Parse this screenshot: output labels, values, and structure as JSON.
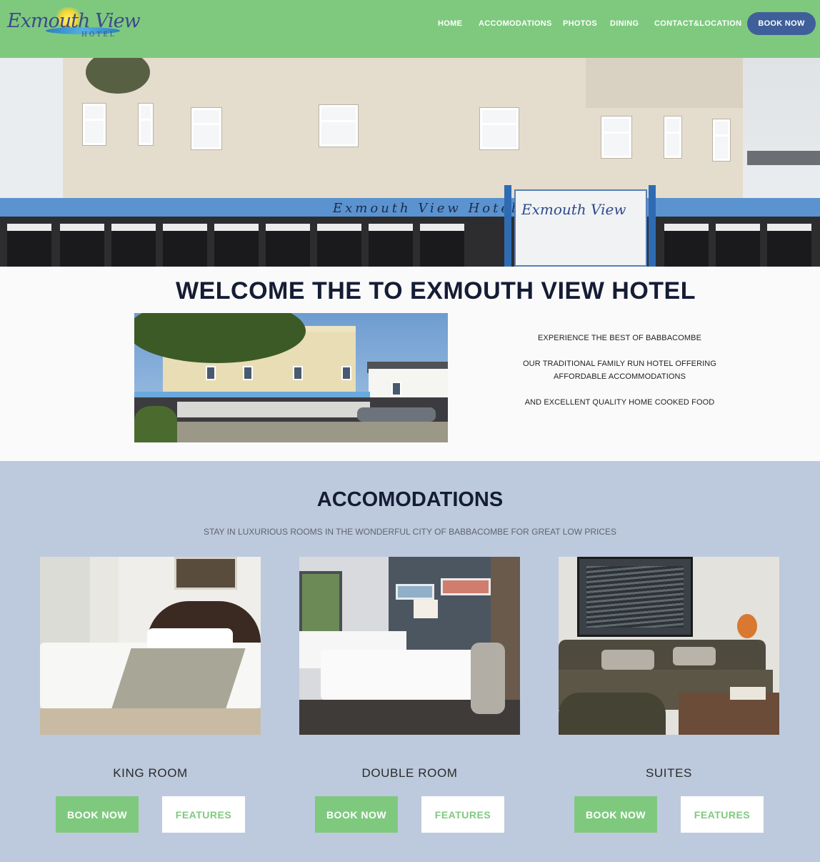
{
  "header": {
    "logo": {
      "name": "Exmouth View",
      "sub": "HOTEL"
    },
    "nav": [
      {
        "label": "HOME"
      },
      {
        "label": "ACCOMODATIONS"
      },
      {
        "label": "PHOTOS"
      },
      {
        "label": "DINING"
      },
      {
        "label": "CONTACT&LOCATION"
      }
    ],
    "book_label": "BOOK NOW"
  },
  "hero": {
    "canopy_text": "Exmouth  View  Hotel",
    "sign_text": "Exmouth View"
  },
  "welcome": {
    "title": "WELCOME THE TO EXMOUTH VIEW HOTEL",
    "lines": [
      "EXPERIENCE THE BEST OF BABBACOMBE",
      "OUR TRADITIONAL FAMILY RUN HOTEL OFFERING AFFORDABLE ACCOMMODATIONS",
      "AND EXCELLENT QUALITY HOME COOKED FOOD"
    ]
  },
  "accomodations": {
    "title": "ACCOMODATIONS",
    "subtitle": "STAY IN LUXURIOUS ROOMS IN THE WONDERFUL CITY OF BABBACOMBE FOR GREAT LOW PRICES",
    "rooms": [
      {
        "name": "KING ROOM",
        "book_label": "BOOK NOW",
        "features_label": "FEATURES"
      },
      {
        "name": "DOUBLE ROOM",
        "book_label": "BOOK NOW",
        "features_label": "FEATURES"
      },
      {
        "name": "SUITES",
        "book_label": "BOOK NOW",
        "features_label": "FEATURES"
      }
    ]
  },
  "colors": {
    "header_green": "#7fc97f",
    "nav_book_blue": "#3f5f9a",
    "accom_bg": "#bdcadd",
    "title_navy": "#151c35"
  }
}
